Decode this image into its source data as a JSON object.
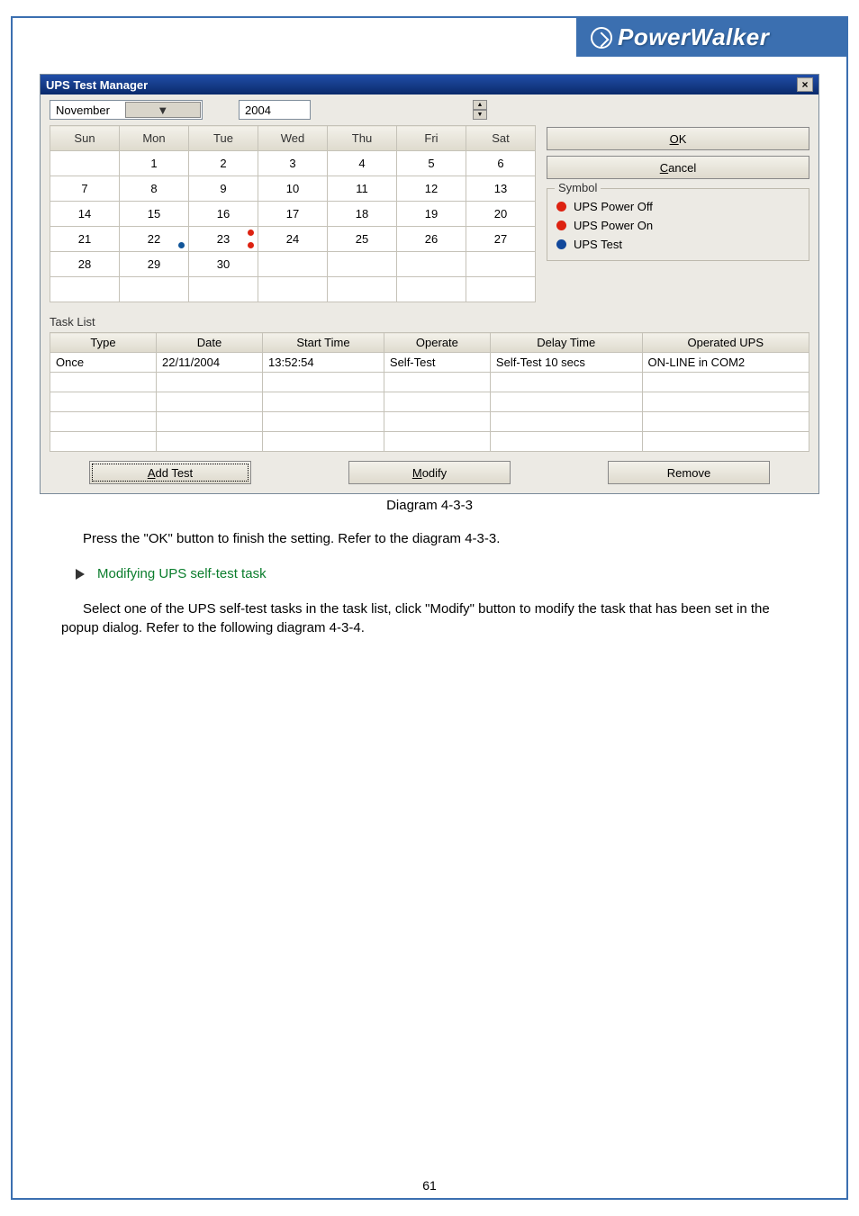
{
  "logo": {
    "text": "PowerWalker"
  },
  "dialog": {
    "title": "UPS Test Manager",
    "month": "November",
    "year": "2004",
    "days": [
      "Sun",
      "Mon",
      "Tue",
      "Wed",
      "Thu",
      "Fri",
      "Sat"
    ],
    "ok": "OK",
    "cancel": "Cancel",
    "symbol_title": "Symbol",
    "legend": {
      "off": "UPS Power Off",
      "on": "UPS Power On",
      "test": "UPS Test"
    },
    "task_list_label": "Task List",
    "task_headers": [
      "Type",
      "Date",
      "Start Time",
      "Operate",
      "Delay Time",
      "Operated UPS"
    ],
    "task_row": {
      "type": "Once",
      "date": "22/11/2004",
      "start": "13:52:54",
      "operate": "Self-Test",
      "delay": "Self-Test 10 secs",
      "ups": "ON-LINE in COM2"
    },
    "add": "Add Test",
    "modify": "Modify",
    "remove": "Remove",
    "weeks": [
      [
        "",
        "1",
        "2",
        "3",
        "4",
        "5",
        "6"
      ],
      [
        "7",
        "8",
        "9",
        "10",
        "11",
        "12",
        "13"
      ],
      [
        "14",
        "15",
        "16",
        "17",
        "18",
        "19",
        "20"
      ],
      [
        "21",
        "22",
        "23",
        "24",
        "25",
        "26",
        "27"
      ],
      [
        "28",
        "29",
        "30",
        "",
        "",
        "",
        ""
      ],
      [
        "",
        "",
        "",
        "",
        "",
        "",
        ""
      ]
    ]
  },
  "caption": "Diagram 4-3-3",
  "para1": "Press the \"OK\" button to finish the setting. Refer to the diagram 4-3-3.",
  "bullet": "Modifying UPS self-test task",
  "para2": "Select one of the UPS self-test tasks in the task list, click \"Modify\" button to modify the task that has been set in the popup dialog. Refer to the following diagram 4-3-4.",
  "page_number": "61"
}
